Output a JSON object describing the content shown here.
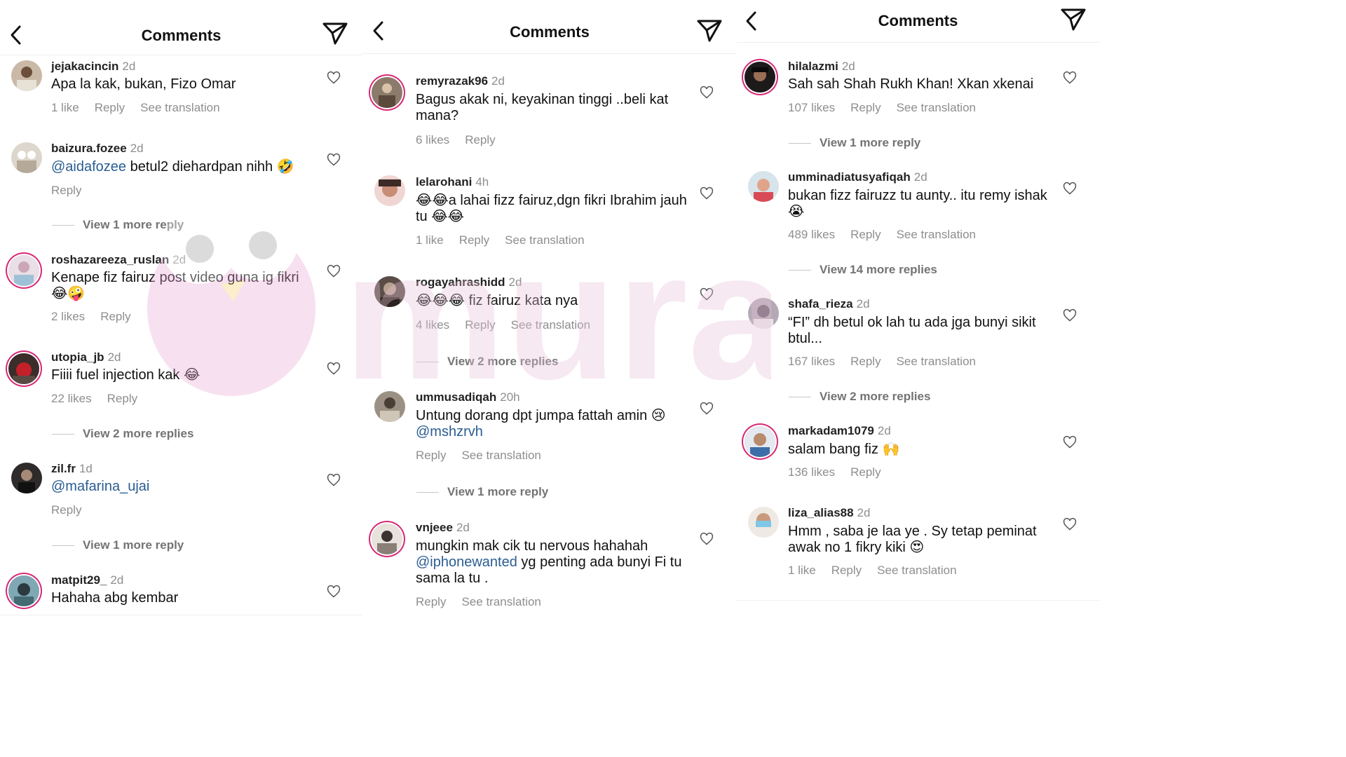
{
  "header_title": "Comments",
  "watermark": "murai",
  "colors": {
    "mention": "#2a5d92",
    "story_ring": "#d62976",
    "meta": "#8e8e8e"
  },
  "icons": {
    "back": "chevron-left-icon",
    "send": "paper-plane-icon",
    "like": "heart-outline-icon"
  },
  "panels": [
    {
      "comments": [
        {
          "user": "jejakacincin",
          "age": "2d",
          "text": "Apa la kak, bukan, Fizo Omar",
          "likes": "1 like",
          "reply": "Reply",
          "translate": "See translation"
        },
        {
          "user": "baizura.fozee",
          "age": "2d",
          "mention": "@aidafozee",
          "text": " betul2 diehardpan nihh 🤣",
          "reply": "Reply",
          "view_more": "View 1 more reply"
        },
        {
          "user": "roshazareeza_ruslan",
          "age": "2d",
          "text": "Kenape fiz fairuz post video guna ig fikri 😂🤪",
          "likes": "2 likes",
          "reply": "Reply"
        },
        {
          "user": "utopia_jb",
          "age": "2d",
          "text": "Fiiii fuel injection kak 😂",
          "likes": "22 likes",
          "reply": "Reply",
          "view_more": "View 2 more replies"
        },
        {
          "user": "zil.fr",
          "age": "1d",
          "mention": "@mafarina_ujai",
          "text": "",
          "reply": "Reply",
          "view_more": "View 1 more reply"
        },
        {
          "user": "matpit29_",
          "age": "2d",
          "text": "Hahaha abg kembar"
        }
      ]
    },
    {
      "comments": [
        {
          "user": "remyrazak96",
          "age": "2d",
          "text": "Bagus akak ni, keyakinan tinggi ..beli kat mana?",
          "likes": "6 likes",
          "reply": "Reply"
        },
        {
          "user": "lelarohani",
          "age": "4h",
          "text": "😂😂a lahai fizz fairuz,dgn fikri Ibrahim jauh tu 😂😂",
          "likes": "1 like",
          "reply": "Reply",
          "translate": "See translation"
        },
        {
          "user": "rogayahrashidd",
          "age": "2d",
          "text": "😂😂😂 fiz fairuz kata nya",
          "likes": "4 likes",
          "reply": "Reply",
          "translate": "See translation",
          "view_more": "View 2 more replies"
        },
        {
          "user": "ummusadiqah",
          "age": "20h",
          "text": "Untung dorang dpt jumpa fattah amin 😢 ",
          "mention": "@mshzrvh",
          "reply": "Reply",
          "translate": "See translation",
          "view_more": "View 1 more reply"
        },
        {
          "user": "vnjeee",
          "age": "2d",
          "text": "mungkin mak cik tu nervous hahahah ",
          "mention": "@iphonewanted",
          "text_after": " yg penting ada bunyi Fi tu sama la tu .",
          "reply": "Reply",
          "translate": "See translation"
        }
      ]
    },
    {
      "comments": [
        {
          "user": "hilalazmi",
          "age": "2d",
          "text": "Sah sah Shah Rukh Khan! Xkan xkenai",
          "likes": "107 likes",
          "reply": "Reply",
          "translate": "See translation",
          "view_more": "View 1 more reply"
        },
        {
          "user": "umminadiatusyafiqah",
          "age": "2d",
          "text": "bukan fizz fairuzz tu aunty.. itu remy ishak 😭",
          "likes": "489 likes",
          "reply": "Reply",
          "translate": "See translation",
          "view_more": "View 14 more replies"
        },
        {
          "user": "shafa_rieza",
          "age": "2d",
          "text": "“FI” dh betul ok lah tu ada jga bunyi sikit btul...",
          "likes": "167 likes",
          "reply": "Reply",
          "translate": "See translation",
          "view_more": "View 2 more replies"
        },
        {
          "user": "markadam1079",
          "age": "2d",
          "text": "salam bang fiz 🙌",
          "likes": "136 likes",
          "reply": "Reply"
        },
        {
          "user": "liza_alias88",
          "age": "2d",
          "text": "Hmm , saba je laa ye . Sy tetap peminat awak no 1 fikry kiki 😍",
          "likes": "1 like",
          "reply": "Reply",
          "translate": "See translation"
        }
      ]
    }
  ]
}
